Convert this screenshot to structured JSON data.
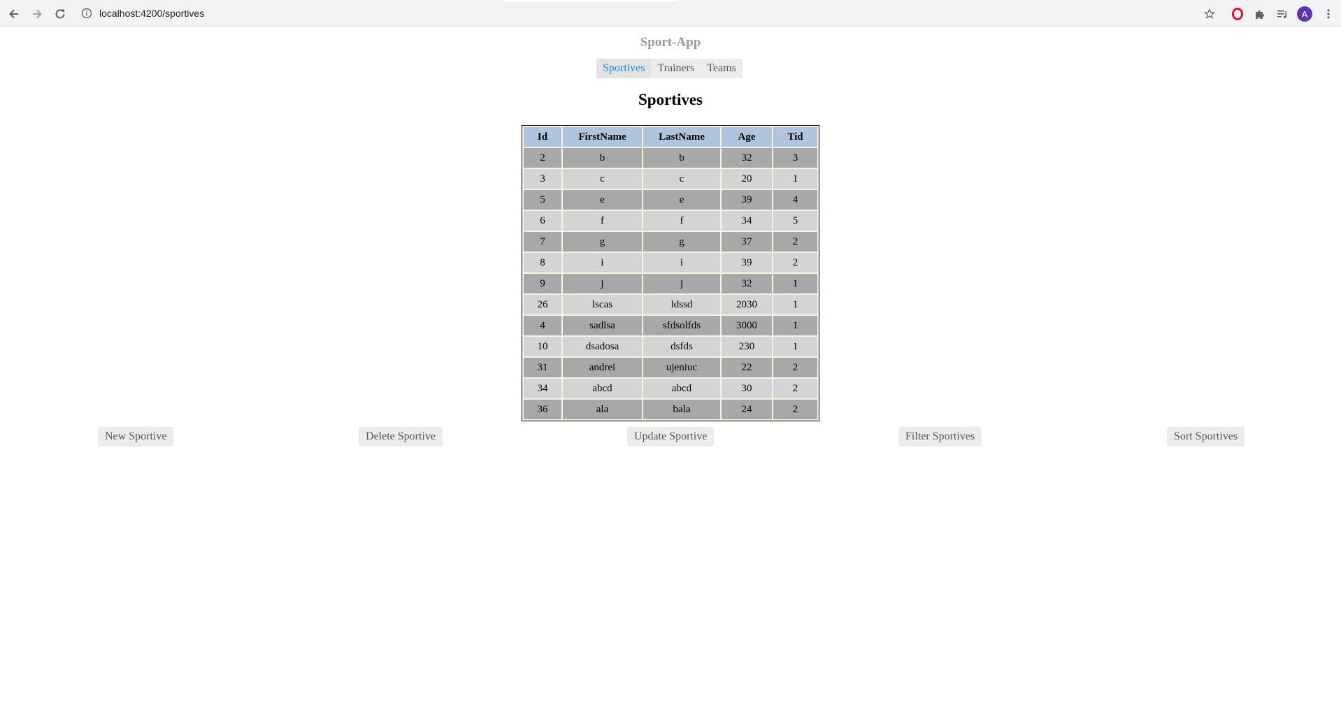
{
  "browser": {
    "url": "localhost:4200/sportives",
    "avatar_letter": "A"
  },
  "app": {
    "title": "Sport-App",
    "nav": [
      {
        "label": "Sportives",
        "active": true
      },
      {
        "label": "Trainers",
        "active": false
      },
      {
        "label": "Teams",
        "active": false
      }
    ]
  },
  "page": {
    "heading": "Sportives"
  },
  "table": {
    "columns": [
      "Id",
      "FirstName",
      "LastName",
      "Age",
      "Tid"
    ],
    "rows": [
      [
        "2",
        "b",
        "b",
        "32",
        "3"
      ],
      [
        "3",
        "c",
        "c",
        "20",
        "1"
      ],
      [
        "5",
        "e",
        "e",
        "39",
        "4"
      ],
      [
        "6",
        "f",
        "f",
        "34",
        "5"
      ],
      [
        "7",
        "g",
        "g",
        "37",
        "2"
      ],
      [
        "8",
        "i",
        "i",
        "39",
        "2"
      ],
      [
        "9",
        "j",
        "j",
        "32",
        "1"
      ],
      [
        "26",
        "lscas",
        "ldssd",
        "2030",
        "1"
      ],
      [
        "4",
        "sadlsa",
        "sfdsolfds",
        "3000",
        "1"
      ],
      [
        "10",
        "dsadosa",
        "dsfds",
        "230",
        "1"
      ],
      [
        "31",
        "andrei",
        "ujeniuc",
        "22",
        "2"
      ],
      [
        "34",
        "abcd",
        "abcd",
        "30",
        "2"
      ],
      [
        "36",
        "ala",
        "bala",
        "24",
        "2"
      ]
    ]
  },
  "actions": {
    "new": "New Sportive",
    "delete": "Delete Sportive",
    "update": "Update Sportive",
    "filter": "Filter Sportives",
    "sort": "Sort Sportives"
  },
  "colors": {
    "header_bg": "#b0c4de",
    "row_odd": "#a8a8a8",
    "row_even": "#d4d4d4",
    "active_tab": "#1b8ed1"
  },
  "icons": [
    "back-arrow-icon",
    "forward-arrow-icon",
    "reload-icon",
    "info-icon",
    "star-icon",
    "opera-icon",
    "puzzle-icon",
    "media-queue-icon",
    "kebab-menu-icon"
  ]
}
